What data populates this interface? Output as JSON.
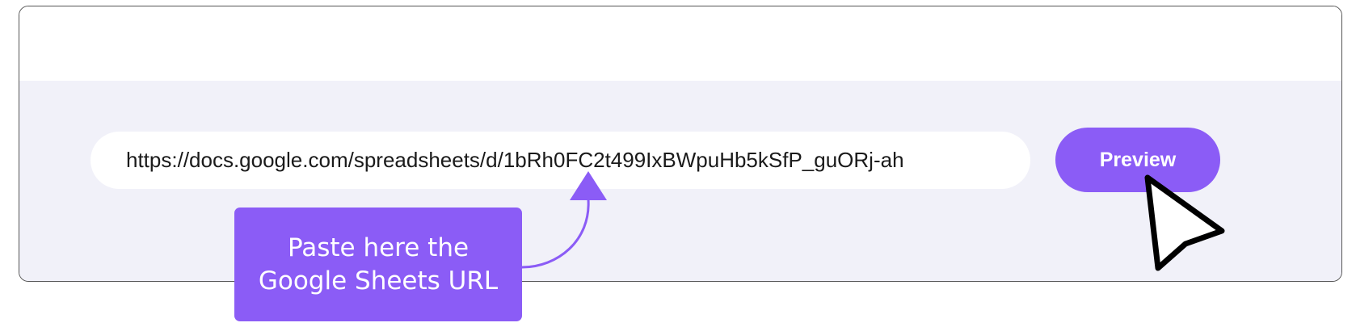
{
  "url_field": {
    "value": "https://docs.google.com/spreadsheets/d/1bRh0FC2t499IxBWpuHb5kSfP_guORj-ah"
  },
  "preview_button": {
    "label": "Preview"
  },
  "callout": {
    "line1": "Paste here the",
    "line2": "Google Sheets URL"
  },
  "colors": {
    "accent": "#8b5cf6",
    "band_background": "#f1f1f9",
    "card_border": "#555555",
    "input_background": "#ffffff"
  },
  "icons": {
    "cursor": "mouse-pointer-icon",
    "annotation": "curved-arrow-icon"
  }
}
